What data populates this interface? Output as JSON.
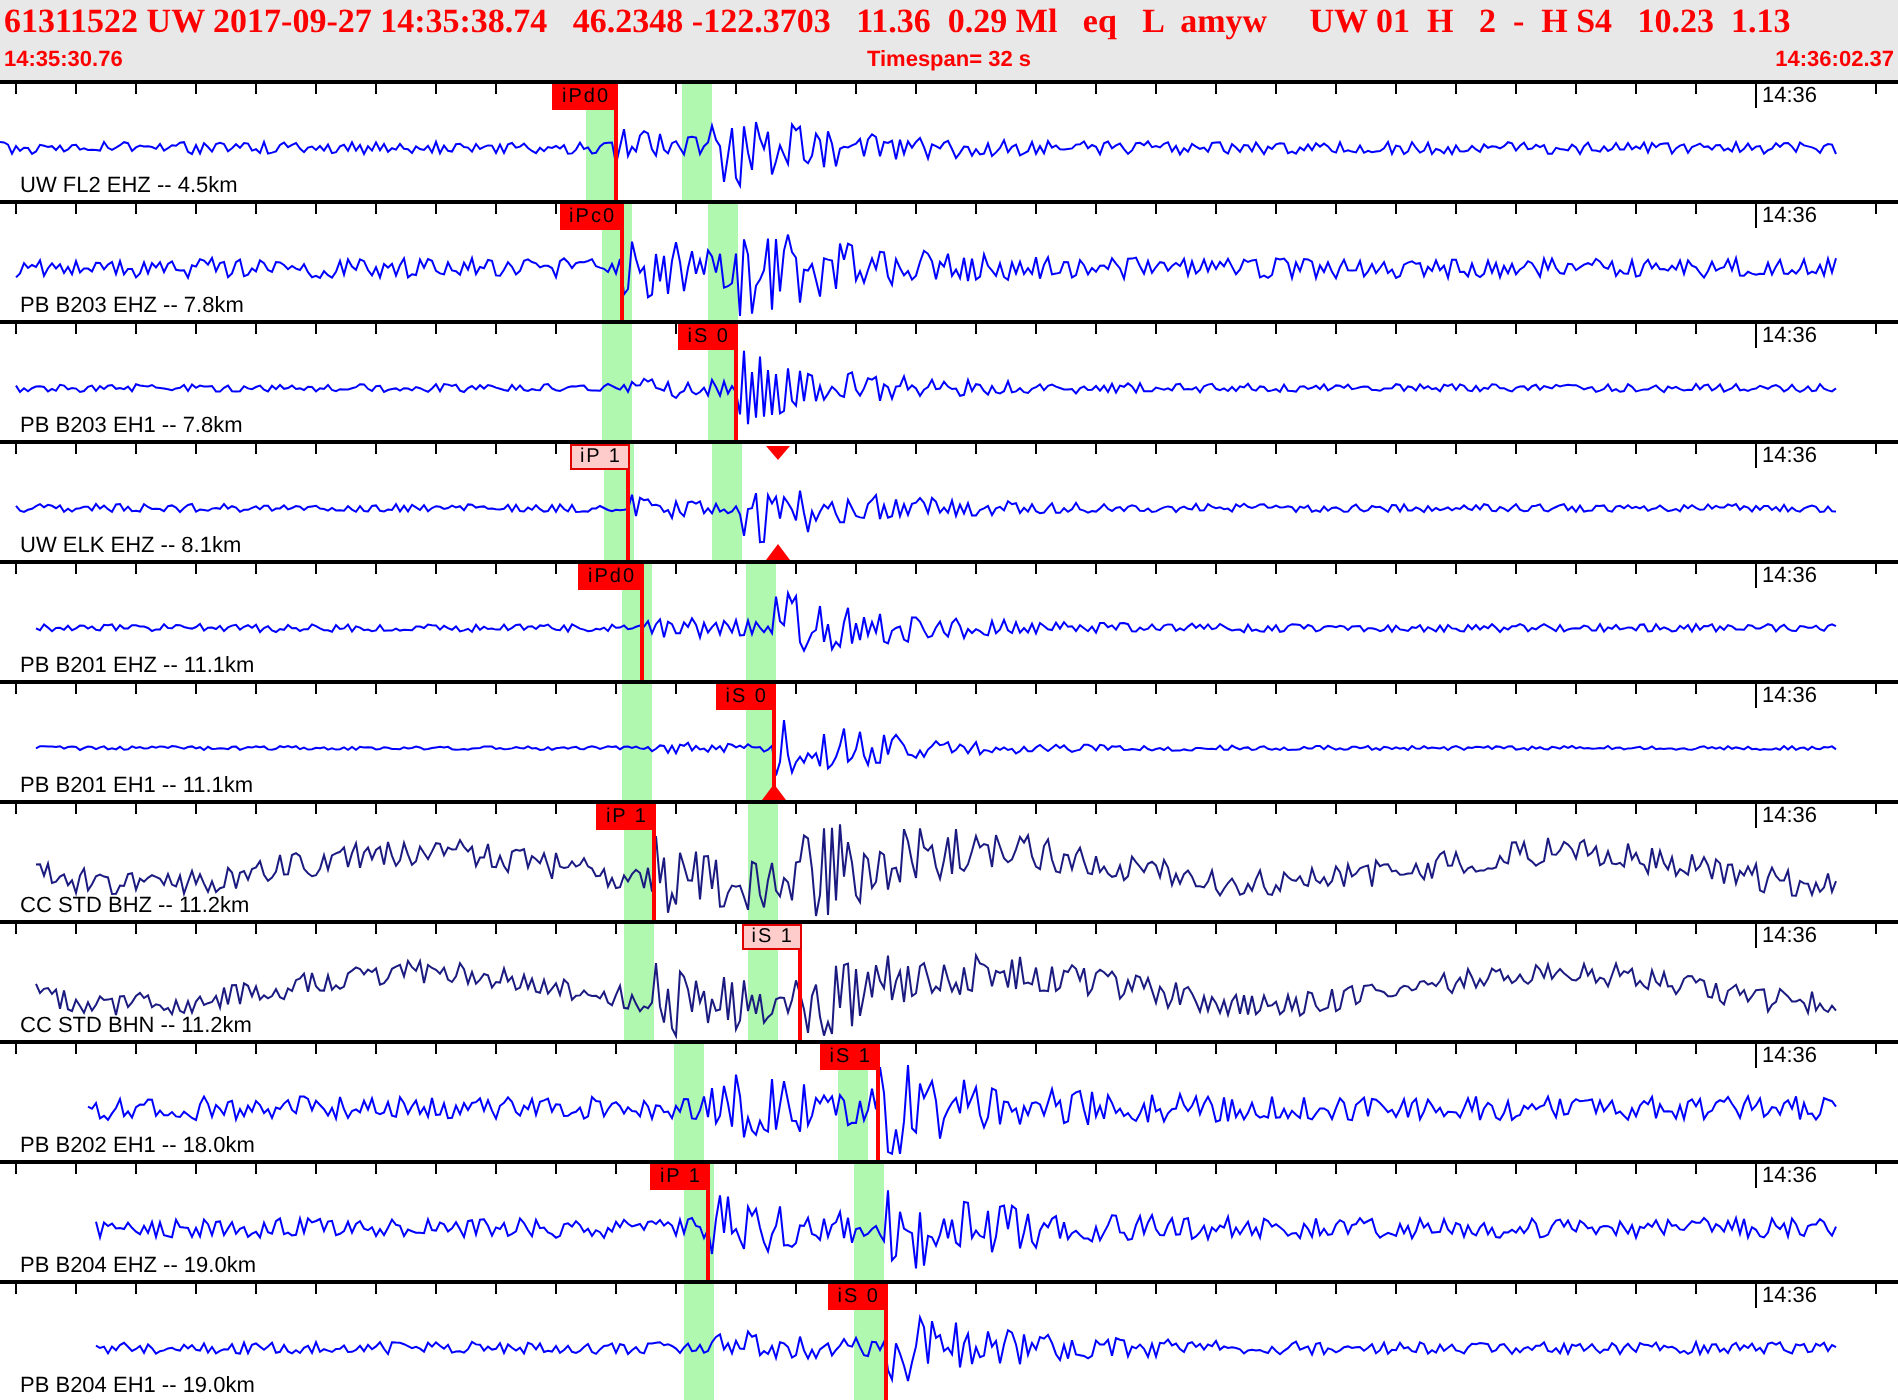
{
  "header": {
    "event_summary": "61311522 UW 2017-09-27 14:35:38.74   46.2348 -122.3703   11.36  0.29 Ml   eq   L  amyw     UW 01  H   2  -  H S4   10.23  1.13",
    "start_time": "14:35:30.76",
    "timespan": "Timespan=  32 s",
    "end_time": "14:36:02.37"
  },
  "traces": [
    {
      "label": "UW FL2 EHZ -- 4.5km",
      "time_label": "14:36",
      "color": "#0000ff",
      "picks": [
        {
          "label": "iPd0",
          "color": "#ff0000"
        }
      ]
    },
    {
      "label": "PB B203 EHZ -- 7.8km",
      "time_label": "14:36",
      "color": "#0000ff",
      "picks": [
        {
          "label": "iPc0",
          "color": "#ff0000"
        }
      ]
    },
    {
      "label": "PB B203 EH1 -- 7.8km",
      "time_label": "14:36",
      "color": "#0000ff",
      "picks": [
        {
          "label": "iS 0",
          "color": "#ff0000"
        }
      ]
    },
    {
      "label": "UW ELK EHZ -- 8.1km",
      "time_label": "14:36",
      "color": "#0000ff",
      "picks": [
        {
          "label": "iP 1",
          "color": "#ffcccc"
        }
      ]
    },
    {
      "label": "PB B201 EHZ -- 11.1km",
      "time_label": "14:36",
      "color": "#0000ff",
      "picks": [
        {
          "label": "iPd0",
          "color": "#ff0000"
        }
      ]
    },
    {
      "label": "PB B201 EH1 -- 11.1km",
      "time_label": "14:36",
      "color": "#0000ff",
      "picks": [
        {
          "label": "iS 0",
          "color": "#ff0000"
        }
      ]
    },
    {
      "label": "CC STD BHZ -- 11.2km",
      "time_label": "14:36",
      "color": "#1a1a80",
      "picks": [
        {
          "label": "iP 1",
          "color": "#ff0000"
        }
      ]
    },
    {
      "label": "CC STD BHN -- 11.2km",
      "time_label": "14:36",
      "color": "#1a1a80",
      "picks": [
        {
          "label": "iS 1",
          "color": "#ffcccc"
        }
      ]
    },
    {
      "label": "PB B202 EH1 -- 18.0km",
      "time_label": "14:36",
      "color": "#0000ff",
      "picks": [
        {
          "label": "iS 1",
          "color": "#ff0000"
        }
      ]
    },
    {
      "label": "PB B204 EHZ -- 19.0km",
      "time_label": "14:36",
      "color": "#0000ff",
      "picks": [
        {
          "label": "iP 1",
          "color": "#ff0000"
        }
      ]
    },
    {
      "label": "PB B204 EH1 -- 19.0km",
      "time_label": "14:36",
      "color": "#0000ff",
      "picks": [
        {
          "label": "iS 0",
          "color": "#ff0000"
        }
      ]
    }
  ]
}
